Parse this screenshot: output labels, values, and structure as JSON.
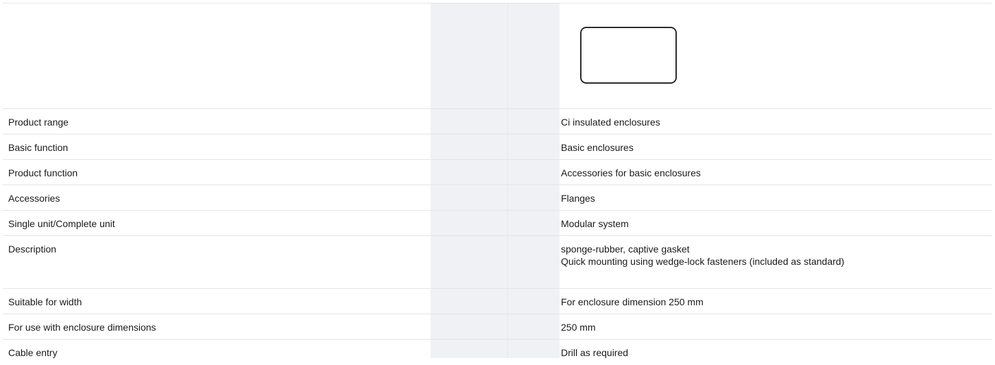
{
  "header": {
    "image_icon": "enclosure-flange-icon"
  },
  "attributes": [
    {
      "label": "Product range",
      "value": [
        "Ci insulated enclosures"
      ]
    },
    {
      "label": "Basic function",
      "value": [
        "Basic enclosures"
      ]
    },
    {
      "label": "Product function",
      "value": [
        "Accessories for basic enclosures"
      ]
    },
    {
      "label": "Accessories",
      "value": [
        "Flanges"
      ]
    },
    {
      "label": "Single unit/Complete unit",
      "value": [
        "Modular system"
      ]
    },
    {
      "label": "Description",
      "value": [
        "sponge-rubber, captive gasket",
        "Quick mounting using wedge-lock fasteners (included as standard)"
      ]
    },
    {
      "label": "Suitable for width",
      "value": [
        "For enclosure dimension 250 mm"
      ]
    },
    {
      "label": "For use with enclosure dimensions",
      "value": [
        "250 mm"
      ]
    },
    {
      "label": "Cable entry",
      "value": [
        "Drill as required"
      ]
    }
  ]
}
